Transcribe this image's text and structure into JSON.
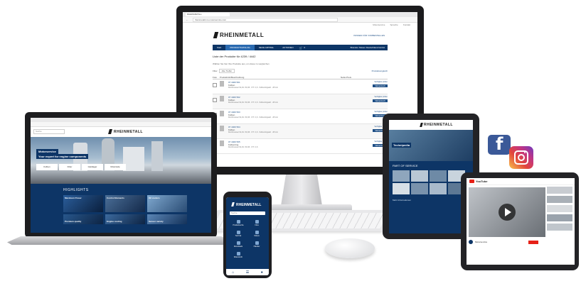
{
  "monitor": {
    "browser_tab": "RHEINMETALL",
    "url": "rheinmetall.ms-motorservice.com",
    "top_links": [
      "Motorservice",
      "Sprache",
      "Kontakt"
    ],
    "brand": "RHEINMETALL",
    "header_right": "PASSEN FÜR VORBESTELLEN",
    "nav": [
      "Start",
      "PRODUKTKATALOG",
      "NEUE ARTIKEL",
      "AKTIONEN",
      "0"
    ],
    "nav_right": "Brandon Nissen Deutschland GmbH",
    "page_heading": "Liste der Produkte für 4239 / 4442",
    "subtext": "Wählen Sie hier Ihre Produkte aus, um diese zu vergleichen",
    "filter_label": "Filter",
    "filter_value": "Alle Treffer",
    "compare_label": "Produktvergleich",
    "columns": [
      "Foto",
      "Produktinfo/Beschreibung",
      "",
      "Netto-Preis"
    ],
    "rows": [
      {
        "id": "07 4400 501",
        "desc": "Kolben",
        "detail": "Durchmesser 91,91 / 91,96 · OT / 1,6 · Kolbenringsatz · 28 mm",
        "status": "Verfügbar prüfen",
        "button": "Warenkorb"
      },
      {
        "id": "07 4400 502",
        "desc": "Kolben",
        "detail": "Durchmesser 91,91 / 91,96 · OT / 1,6 · Kolbenringsatz · 28 mm",
        "status": "Verfügbar prüfen",
        "button": "Warenkorb"
      },
      {
        "id": "07 4400 503",
        "desc": "Kolben",
        "detail": "Durchmesser 91,91 / 91,96 · OT / 1,6 · Kolbenringsatz · 28 mm",
        "status": "Verfügbar prüfen",
        "button": "Warenkorb"
      },
      {
        "id": "07 4400 504",
        "desc": "Kolben",
        "detail": "Durchmesser 91,91 / 91,96 · OT / 1,6 · Kolbenringsatz · 28 mm",
        "status": "Verfügbar prüfen",
        "button": "Warenkorb"
      },
      {
        "id": "07 4400 505",
        "desc": "Kolbenring",
        "detail": "Durchmesser 91,91 / 91,96 · OT / 1,6",
        "status": "Verfügbar prüfen",
        "button": "Warenkorb"
      }
    ]
  },
  "laptop": {
    "brand": "RHEINMETALL",
    "search_placeholder": "Suche",
    "hero_line1": "Motorservice",
    "hero_line2": "Your expert for engine components",
    "hero_tiles": [
      "Kolben",
      "Filter",
      "Gleitlager",
      "Motorteile"
    ],
    "highlights_title": "HIGHLIGHTS",
    "cards": [
      "Maximum Power",
      "Control Elements",
      "Oil coolers",
      "Premium quality",
      "Engine cooling",
      "Sensor variety"
    ]
  },
  "phone": {
    "brand": "RHEINMETALL",
    "search_placeholder": "Suche",
    "items": [
      "Produktsuche",
      "Infos",
      "Technik",
      "Videos",
      "Downloads",
      "Händler",
      "Warenkorb"
    ]
  },
  "tablet": {
    "brand": "RHEINMETALL",
    "banner": "Technipedia",
    "section_title": "PART OF SERVICE",
    "footer_link": "Mehr Informationen"
  },
  "tablet2": {
    "site": "YouTube",
    "channel": "Motorservice",
    "play_icon": "play-icon"
  },
  "social": {
    "facebook_letter": "f",
    "facebook_color": "#3b5998",
    "instagram_color": "#c13584"
  }
}
